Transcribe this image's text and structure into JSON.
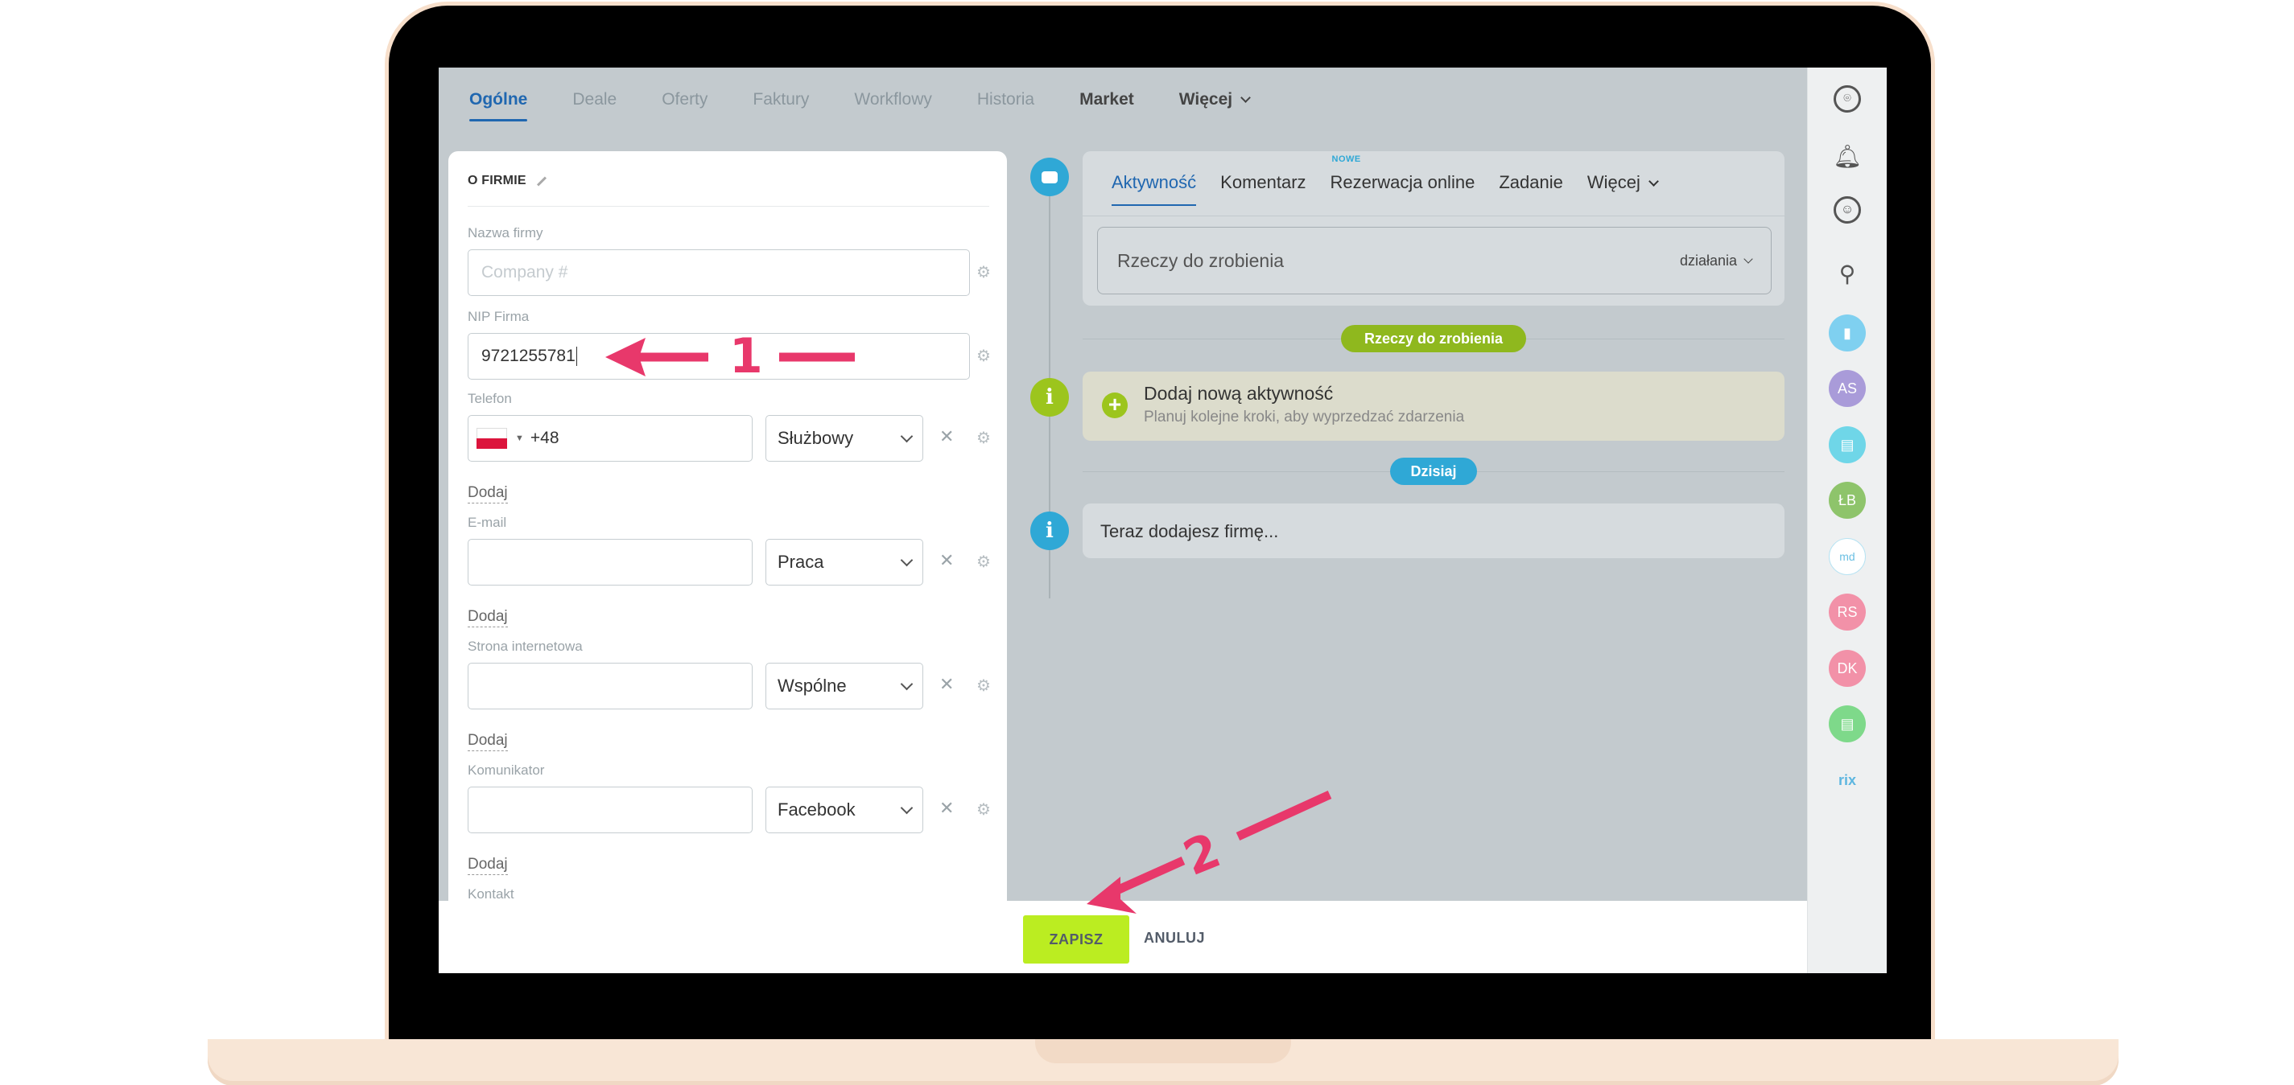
{
  "top_tabs": [
    {
      "label": "Ogólne",
      "state": "active"
    },
    {
      "label": "Deale",
      "state": ""
    },
    {
      "label": "Oferty",
      "state": ""
    },
    {
      "label": "Faktury",
      "state": ""
    },
    {
      "label": "Workflowy",
      "state": ""
    },
    {
      "label": "Historia",
      "state": ""
    },
    {
      "label": "Market",
      "state": "dark"
    },
    {
      "label": "Więcej",
      "state": "dark"
    }
  ],
  "form": {
    "section_title": "O FIRMIE",
    "company_name": {
      "label": "Nazwa firmy",
      "placeholder": "Company #"
    },
    "nip": {
      "label": "NIP Firma",
      "value": "9721255781"
    },
    "phone": {
      "label": "Telefon",
      "prefix": "+48",
      "type": "Służbowy"
    },
    "email": {
      "label": "E-mail",
      "value": "",
      "type": "Praca"
    },
    "website": {
      "label": "Strona internetowa",
      "value": "",
      "type": "Wspólne"
    },
    "messenger": {
      "label": "Komunikator",
      "value": "",
      "type": "Facebook"
    },
    "contact": {
      "label": "Kontakt"
    },
    "add_label": "Dodaj",
    "remove_symbol": "✕",
    "settings_symbol": "⚙"
  },
  "activity": {
    "tabs": [
      {
        "label": "Aktywność",
        "state": "active",
        "badge": ""
      },
      {
        "label": "Komentarz",
        "state": "",
        "badge": ""
      },
      {
        "label": "Rezerwacja online",
        "state": "",
        "badge": "NOWE"
      },
      {
        "label": "Zadanie",
        "state": "",
        "badge": ""
      },
      {
        "label": "Więcej",
        "state": "",
        "badge": ""
      }
    ],
    "todo_placeholder": "Rzeczy do zrobienia",
    "actions_label": "działania",
    "todo_pill": "Rzeczy do zrobienia",
    "add_title": "Dodaj nową aktywność",
    "add_subtitle": "Planuj kolejne kroki, aby wyprzedzać zdarzenia",
    "today_pill": "Dzisiaj",
    "info_text": "Teraz dodajesz firmę..."
  },
  "sidebar": {
    "icons": [
      {
        "name": "copilot-icon",
        "text": "⌾",
        "color": ""
      },
      {
        "name": "bell-icon",
        "text": "🔔︎",
        "color": ""
      },
      {
        "name": "chat-support-icon",
        "text": "☺",
        "color": ""
      },
      {
        "name": "search-icon",
        "text": "⚲",
        "color": ""
      },
      {
        "name": "bookmark-icon",
        "text": "▮",
        "color": "#7fd0f0"
      },
      {
        "name": "avatar-as",
        "text": "AS",
        "color": "#a99bd9"
      },
      {
        "name": "chat-group-icon",
        "text": "▤",
        "color": "#6fd6e8"
      },
      {
        "name": "avatar-lb",
        "text": "ŁB",
        "color": "#8ec46b"
      },
      {
        "name": "avatar-logo",
        "text": "md",
        "color": "#ffffff"
      },
      {
        "name": "avatar-rs",
        "text": "RS",
        "color": "#f291a8"
      },
      {
        "name": "avatar-dk",
        "text": "DK",
        "color": "#f291a8"
      },
      {
        "name": "notes-icon",
        "text": "▤",
        "color": "#7ed98a"
      },
      {
        "name": "bitrix-logo",
        "text": "rix",
        "color": "#ffffff"
      }
    ]
  },
  "buttons": {
    "save": "ZAPISZ",
    "cancel": "ANULUJ"
  },
  "annotations": {
    "step1": "1",
    "step2": "2",
    "color": "#e8386b"
  }
}
